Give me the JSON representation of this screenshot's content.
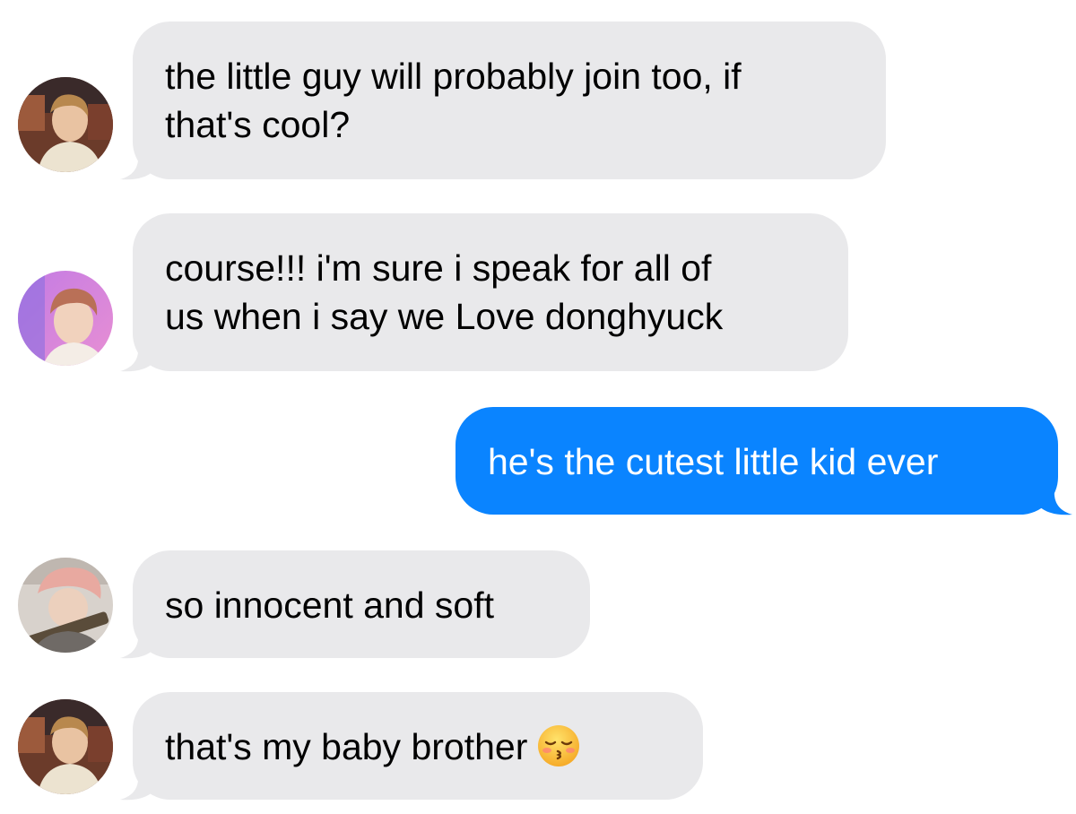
{
  "colors": {
    "incoming_bubble": "#e9e9eb",
    "outgoing_bubble": "#0a84ff",
    "incoming_text": "#000000",
    "outgoing_text": "#ffffff"
  },
  "messages": [
    {
      "direction": "incoming",
      "avatar": "contact-photo-1",
      "lines": [
        "the little guy will probably join too, if",
        "that's cool?"
      ]
    },
    {
      "direction": "incoming",
      "avatar": "contact-photo-2",
      "lines": [
        "course!!! i'm sure i speak for all of",
        "us when i say we Love donghyuck"
      ]
    },
    {
      "direction": "outgoing",
      "lines": [
        "he's the cutest little kid ever"
      ]
    },
    {
      "direction": "incoming",
      "avatar": "contact-photo-3",
      "lines": [
        "so innocent and soft"
      ]
    },
    {
      "direction": "incoming",
      "avatar": "contact-photo-1",
      "lines": [
        "that's my baby brother"
      ],
      "emoji": "kissing-face-with-closed-eyes-emoji"
    }
  ]
}
